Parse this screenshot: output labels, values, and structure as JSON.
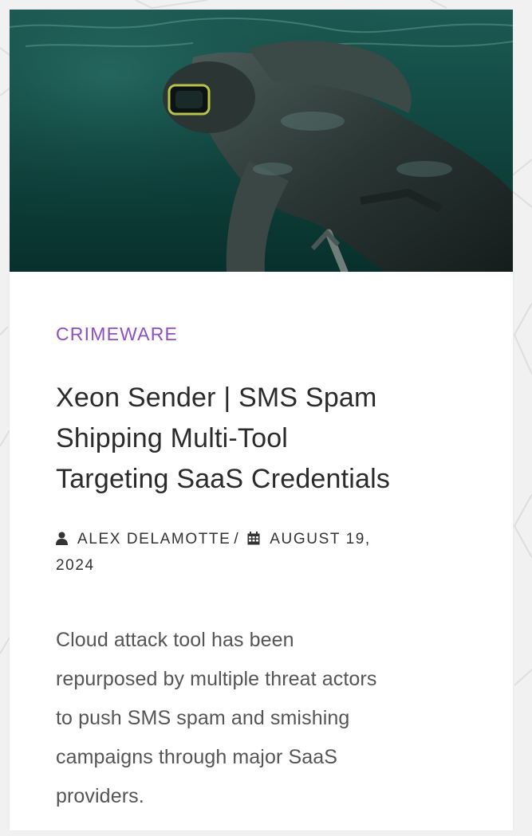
{
  "article": {
    "image_alt": "Diver swimming underwater in a wetsuit and mask",
    "category": "CRIMEWARE",
    "title_lines": [
      "Xeon Sender | SMS Spam",
      "Shipping Multi-Tool",
      "Targeting SaaS Credentials"
    ],
    "author": "ALEX DELAMOTTE",
    "separator": "/",
    "date_part1": "AUGUST 19,",
    "date_part2": "2024",
    "excerpt_lines": [
      "Cloud attack tool has been",
      "repurposed by multiple threat actors",
      "to push SMS spam and smishing",
      "campaigns through major SaaS",
      "providers."
    ]
  },
  "icons": {
    "author": "user-icon",
    "date": "calendar-icon"
  },
  "colors": {
    "category": "#8e4fc4",
    "title": "#2b2b2b",
    "meta": "#333333",
    "excerpt": "#555555",
    "page_background": "#f1f1f1",
    "card_background": "#ffffff",
    "water": "#0e3a36"
  }
}
